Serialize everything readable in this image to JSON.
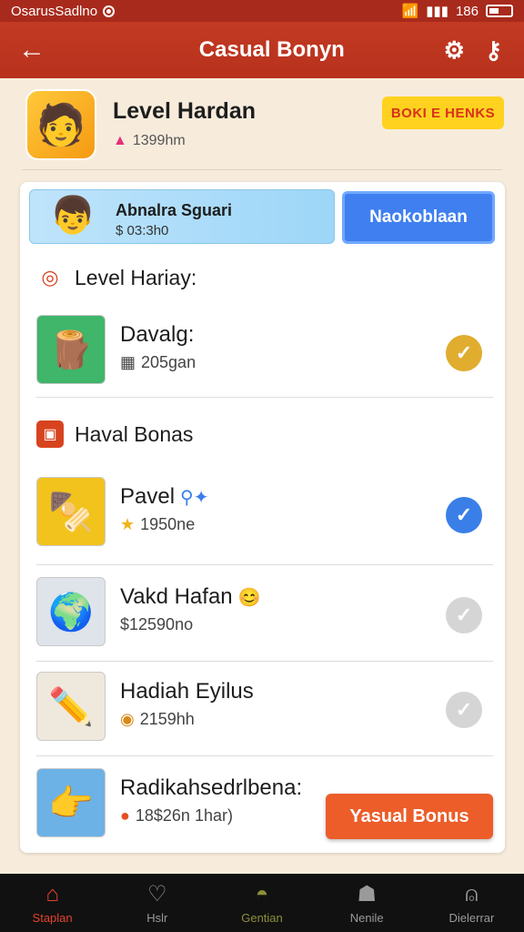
{
  "status": {
    "left_text": "OsarusSadlno",
    "time": "186"
  },
  "appbar": {
    "title": "Casual Bonyn"
  },
  "profile": {
    "name": "Level Hardan",
    "sub": "1399hm",
    "badge": "BOKI E HENKS"
  },
  "promo": {
    "title": "Abnalra Sguari",
    "subtitle": "$ 03:3h0",
    "button": "Naokoblaan"
  },
  "sections": [
    {
      "label": "Level Hariay:"
    },
    {
      "label": "Haval Bonas"
    }
  ],
  "rows": [
    {
      "title": "Davalg:",
      "sub": "205gan",
      "check_color": "#e0ad2f",
      "thumb_color": "#3fb66a",
      "icon": "cup-icon"
    },
    {
      "title": "Pavel",
      "sub": "1950ne",
      "check_color": "#3a7fe8",
      "thumb_color": "#f2c31d",
      "icon": "stick-icon"
    },
    {
      "title": "Vakd Hafan",
      "sub": "$12590no",
      "check_color": "#d5d5d5",
      "thumb_color": "#dfe3ea",
      "icon": "globe-icon"
    },
    {
      "title": "Hadiah Eyilus",
      "sub": "2159hh",
      "check_color": "#d5d5d5",
      "thumb_color": "#efe8dc",
      "icon": "pencil-icon"
    },
    {
      "title": "Radikahsedrlbena:",
      "sub": "18$26n 1har)",
      "check_color": "#e8c48a",
      "thumb_color": "#6cb2e6",
      "icon": "hand-icon"
    }
  ],
  "cta": {
    "label": "Yasual Bonus"
  },
  "bottom_nav": [
    {
      "label": "Staplan",
      "icon": "home-icon"
    },
    {
      "label": "Hslr",
      "icon": "heart-icon"
    },
    {
      "label": "Gentian",
      "icon": "cake-icon"
    },
    {
      "label": "Nenile",
      "icon": "person-icon"
    },
    {
      "label": "Dielerrar",
      "icon": "profile-icon"
    }
  ]
}
